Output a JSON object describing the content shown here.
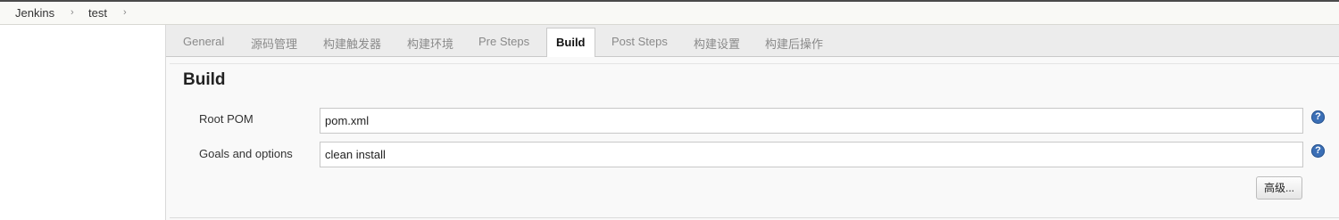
{
  "breadcrumb": {
    "items": [
      "Jenkins",
      "test"
    ],
    "separator": "›"
  },
  "tabs": [
    {
      "label": "General",
      "active": false
    },
    {
      "label": "源码管理",
      "active": false
    },
    {
      "label": "构建触发器",
      "active": false
    },
    {
      "label": "构建环境",
      "active": false
    },
    {
      "label": "Pre Steps",
      "active": false
    },
    {
      "label": "Build",
      "active": true
    },
    {
      "label": "Post Steps",
      "active": false
    },
    {
      "label": "构建设置",
      "active": false
    },
    {
      "label": "构建后操作",
      "active": false
    }
  ],
  "build": {
    "title": "Build",
    "root_pom": {
      "label": "Root POM",
      "value": "pom.xml"
    },
    "goals": {
      "label": "Goals and options",
      "value": "clean install"
    },
    "help_glyph": "?",
    "advanced_label": "高级..."
  },
  "icons": {
    "help": "help-icon",
    "breadcrumb_separator": "chevron-right-icon"
  },
  "colors": {
    "help_icon": "#3b6fb6",
    "tab_bar": "#ececec",
    "active_tab": "#ffffff"
  }
}
